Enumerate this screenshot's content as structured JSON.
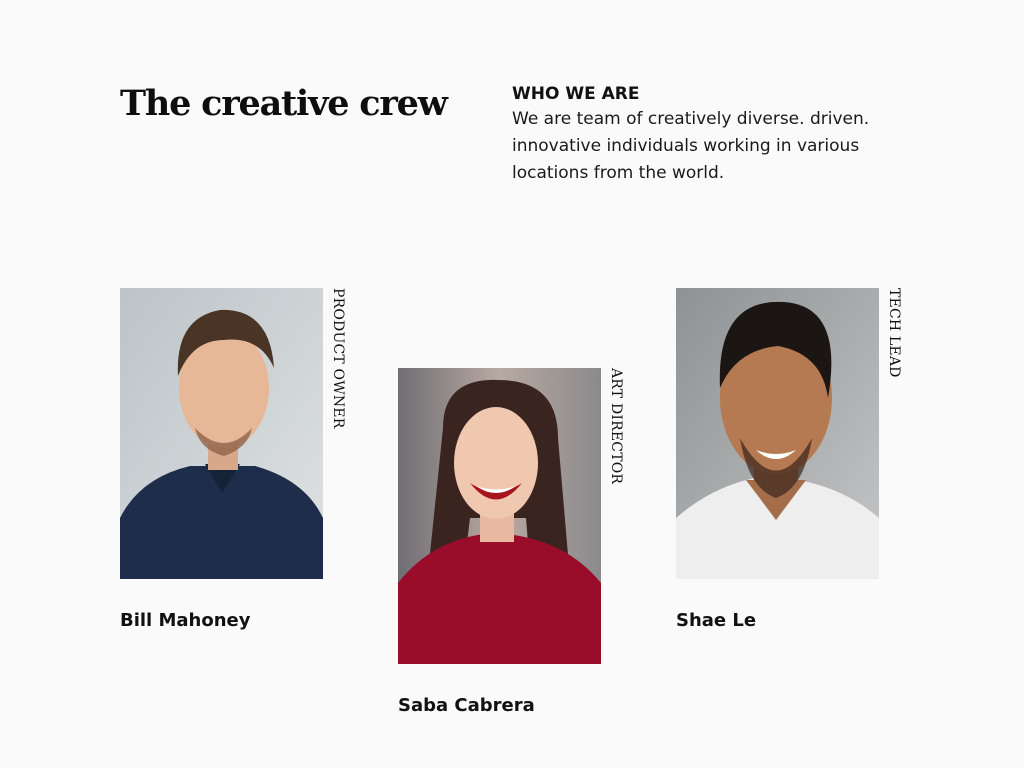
{
  "heading": "The creative crew",
  "intro": {
    "label": "WHO WE ARE",
    "lines": [
      "We are team of creatively diverse. driven.",
      "innovative individuals working in various",
      "locations from the world."
    ]
  },
  "team": [
    {
      "name": "Bill Mahoney",
      "role": "PRODUCT OWNER"
    },
    {
      "name": "Saba Cabrera",
      "role": "ART DIRECTOR"
    },
    {
      "name": "Shae Le",
      "role": "TECH LEAD"
    }
  ]
}
